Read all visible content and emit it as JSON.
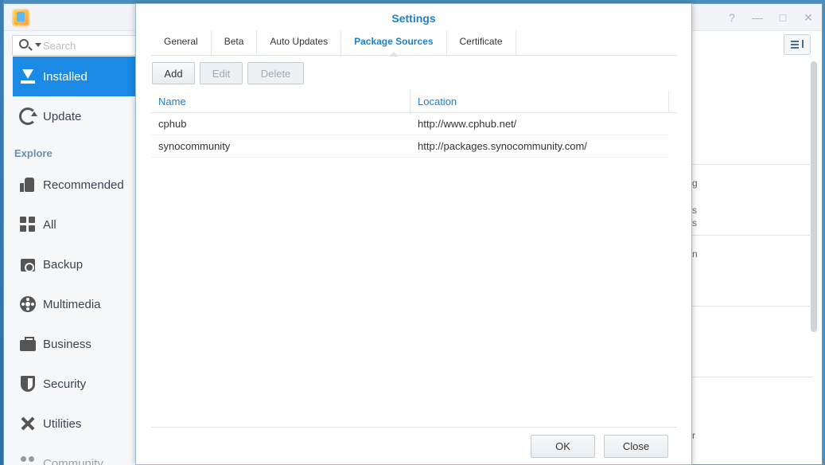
{
  "app": {
    "search_placeholder": "Search",
    "sidebar": {
      "installed": "Installed",
      "update": "Update",
      "explore": "Explore",
      "items": [
        "Recommended",
        "All",
        "Backup",
        "Multimedia",
        "Business",
        "Security",
        "Utilities",
        "Community"
      ]
    },
    "window_controls": {
      "help": "?",
      "minimize": "—",
      "maximize": "□",
      "close": "✕"
    },
    "bg_fragments": [
      "g",
      "s",
      "s",
      "n",
      "r"
    ]
  },
  "dialog": {
    "title": "Settings",
    "tabs": [
      "General",
      "Beta",
      "Auto Updates",
      "Package Sources",
      "Certificate"
    ],
    "active_tab": "Package Sources",
    "toolbar": {
      "add": "Add",
      "edit": "Edit",
      "delete": "Delete"
    },
    "table": {
      "columns": [
        "Name",
        "Location"
      ],
      "rows": [
        {
          "name": "cphub",
          "location": "http://www.cphub.net/"
        },
        {
          "name": "synocommunity",
          "location": "http://packages.synocommunity.com/"
        }
      ]
    },
    "footer": {
      "ok": "OK",
      "close": "Close"
    }
  },
  "colors": {
    "accent": "#1a8ae4",
    "title_blue": "#1f7fc7"
  }
}
